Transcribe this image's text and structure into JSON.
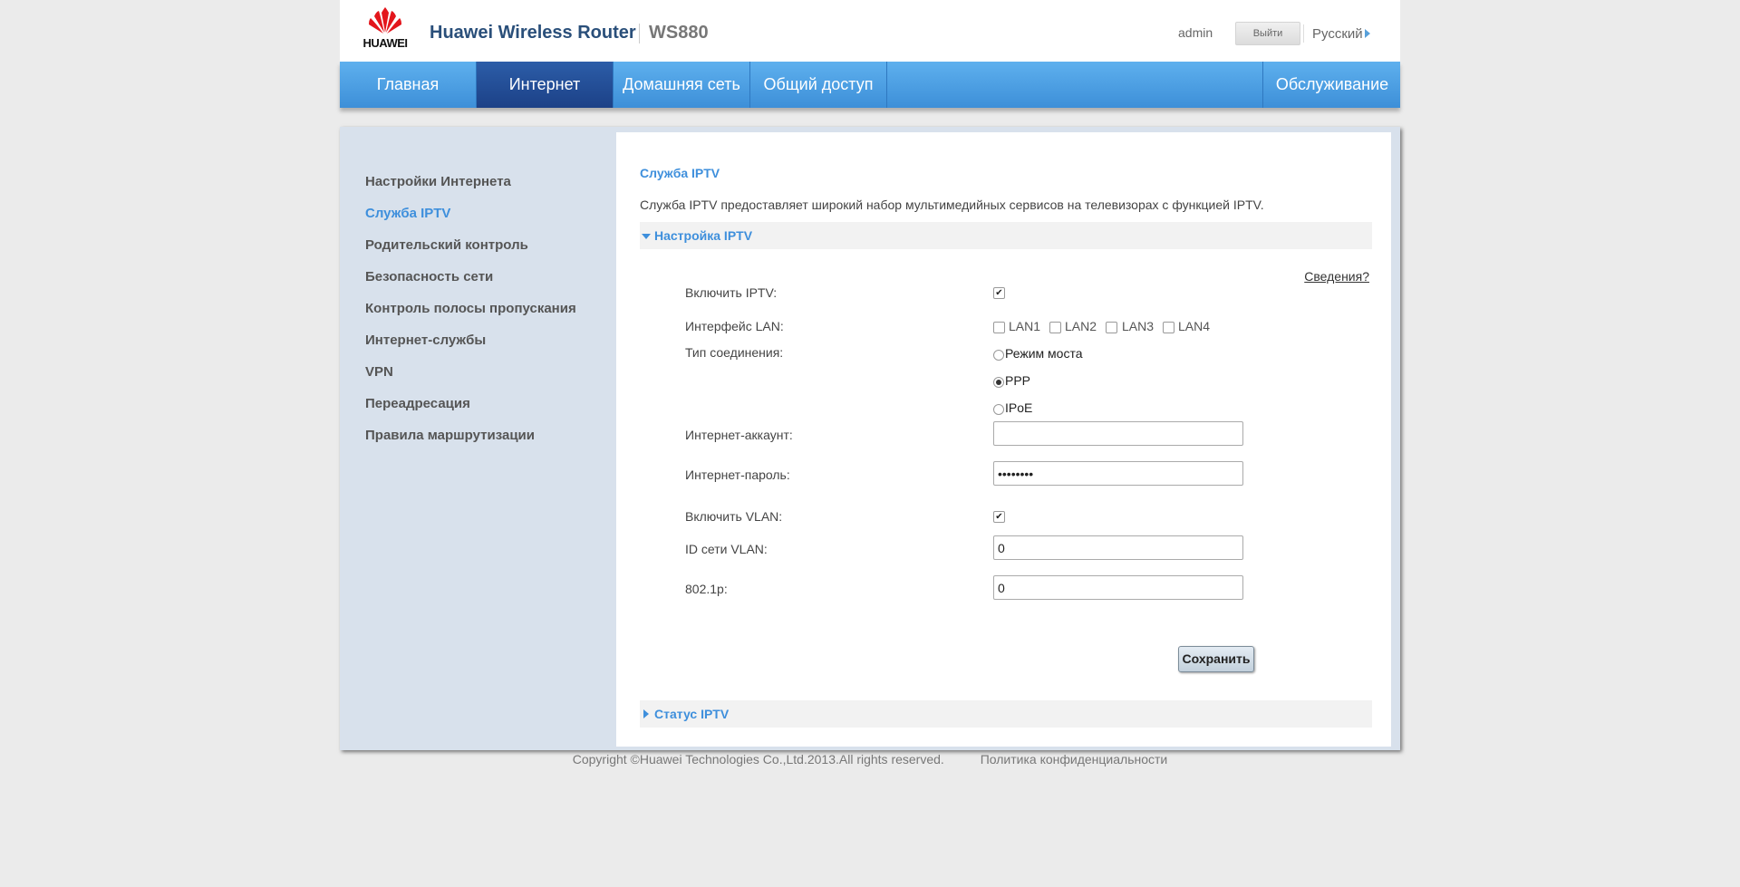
{
  "header": {
    "brand": "HUAWEI",
    "product_title": "Huawei Wireless Router",
    "model": "WS880",
    "user": "admin",
    "logout_label": "Выйти",
    "language": "Русский"
  },
  "nav": {
    "items": [
      {
        "label": "Главная"
      },
      {
        "label": "Интернет",
        "active": true
      },
      {
        "label": "Домашняя сеть"
      },
      {
        "label": "Общий доступ"
      },
      {
        "label": "Обслуживание"
      }
    ]
  },
  "sidebar": {
    "items": [
      {
        "label": "Настройки Интернета"
      },
      {
        "label": "Служба IPTV",
        "active": true
      },
      {
        "label": "Родительский контроль"
      },
      {
        "label": "Безопасность сети"
      },
      {
        "label": "Контроль полосы пропускания"
      },
      {
        "label": "Интернет-службы"
      },
      {
        "label": "VPN"
      },
      {
        "label": "Переадресация"
      },
      {
        "label": "Правила маршрутизации"
      }
    ]
  },
  "main": {
    "title": "Служба IPTV",
    "description": "Служба IPTV предоставляет широкий набор мультимедийных сервисов на телевизорах с функцией IPTV.",
    "section_settings": "Настройка IPTV",
    "help_link": "Сведения?",
    "form": {
      "enable_iptv_label": "Включить IPTV:",
      "enable_iptv": true,
      "lan_label": "Интерфейс LAN:",
      "lan_ports": [
        {
          "label": "LAN1",
          "checked": false
        },
        {
          "label": "LAN2",
          "checked": false
        },
        {
          "label": "LAN3",
          "checked": false
        },
        {
          "label": "LAN4",
          "checked": false
        }
      ],
      "connection_type_label": "Тип соединения:",
      "connection_types": [
        {
          "label": "Режим моста",
          "selected": false
        },
        {
          "label": "PPP",
          "selected": true
        },
        {
          "label": "IPoE",
          "selected": false
        }
      ],
      "account_label": "Интернет-аккаунт:",
      "account_value": "",
      "password_label": "Интернет-пароль:",
      "password_value": "12345678",
      "enable_vlan_label": "Включить VLAN:",
      "enable_vlan": true,
      "vlan_id_label": "ID сети VLAN:",
      "vlan_id_value": "0",
      "priority_label": "802.1p:",
      "priority_value": "0",
      "save_label": "Сохранить"
    },
    "section_status": "Статус IPTV"
  },
  "footer": {
    "copyright": "Copyright ©Huawei Technologies Co.,Ltd.2013.All rights reserved.",
    "privacy": "Политика конфиденциальности"
  },
  "colors": {
    "accent": "#3e8fdc",
    "nav_active": "#1c4187",
    "logo_red": "#e3161c"
  },
  "icons": {
    "logo": "huawei-logo-icon",
    "language_arrow": "triangle-right-icon",
    "section_expanded": "triangle-down-icon",
    "section_collapsed": "triangle-right-icon"
  }
}
